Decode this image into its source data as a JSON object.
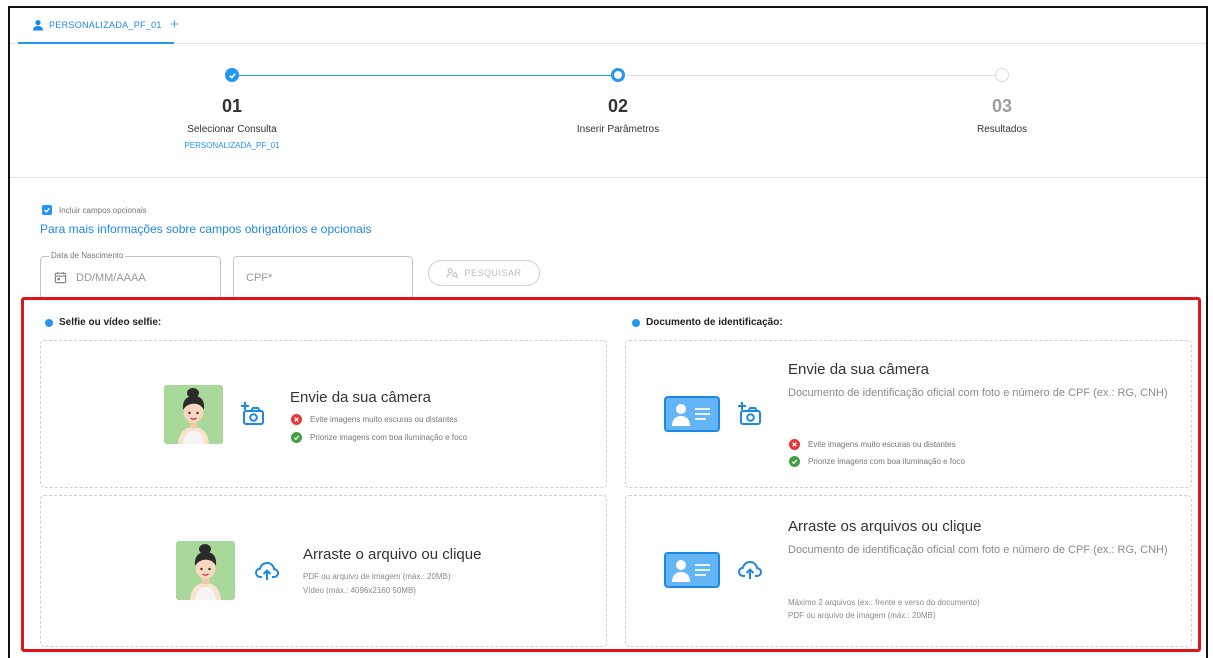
{
  "tabs": [
    {
      "label": "PERSONALIZADA_PF_01"
    }
  ],
  "stepper": {
    "steps": [
      {
        "number": "01",
        "title": "Selecionar Consulta",
        "subtitle": "PERSONALIZADA_PF_01"
      },
      {
        "number": "02",
        "title": "Inserir Parâmetros"
      },
      {
        "number": "03",
        "title": "Resultados"
      }
    ]
  },
  "options": {
    "include_optional_label": "Incluir campos opcionais",
    "include_optional_checked": true,
    "info_link": "Para mais informações sobre campos obrigatórios e opcionais"
  },
  "form": {
    "birth_date": {
      "legend": "Data de Nascimento",
      "placeholder": "DD/MM/AAAA"
    },
    "cpf": {
      "placeholder": "CPF*"
    },
    "search_button": "PESQUISAR"
  },
  "selfie": {
    "section_title": "Selfie ou vídeo selfie:",
    "camera": {
      "title": "Envie da sua câmera",
      "hint_bad": "Evite imagens muito escuras ou distantes",
      "hint_good": "Priorize imagens com boa iluminação e foco"
    },
    "upload": {
      "title": "Arraste o arquivo ou clique",
      "line1": "PDF ou arquivo de imagem (máx.: 20MB)",
      "line2": "Vídeo (máx.: 4096x2160 50MB)"
    }
  },
  "document": {
    "section_title": "Documento de identificação:",
    "camera": {
      "title": "Envie da sua câmera",
      "desc": "Documento de identificação oficial com foto e número de CPF (ex.: RG, CNH)",
      "hint_bad": "Evite imagens muito escuras ou distantes",
      "hint_good": "Priorize imagens com boa iluminação e foco"
    },
    "upload": {
      "title": "Arraste os arquivos ou clique",
      "desc": "Documento de identificação oficial com foto e número de CPF (ex.: RG, CNH)",
      "line1": "Máximo 2 arquivos (ex.: frente e verso do documento)",
      "line2": "PDF ou arquivo de imagem (máx.: 20MB)"
    }
  },
  "colors": {
    "accent": "#2196f3",
    "highlight": "#e0141b",
    "error": "#e53935",
    "success": "#43a047"
  },
  "icons": [
    "user-icon",
    "plus-icon",
    "check-icon",
    "calendar-icon",
    "person-search-icon",
    "info-icon",
    "camera-add-icon",
    "cloud-upload-icon",
    "error-icon",
    "success-icon",
    "id-card-icon"
  ]
}
